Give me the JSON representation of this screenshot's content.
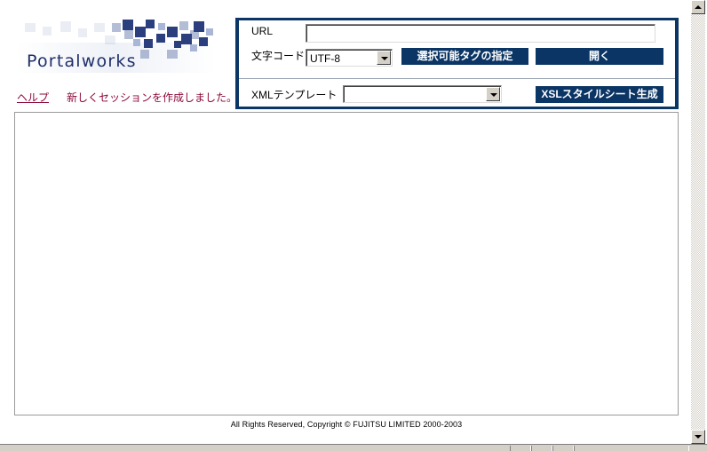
{
  "header": {
    "logo_text": "Portalworks",
    "help_link": "ヘルプ",
    "status_message": "新しくセッションを作成しました。"
  },
  "form": {
    "url_label": "URL",
    "url_value": "",
    "encoding_label": "文字コード",
    "encoding_selected": "UTF-8",
    "select_tags_button": "選択可能タグの指定",
    "open_button": "開く",
    "xml_template_label": "XMLテンプレート",
    "xml_template_selected": "",
    "generate_xsl_button": "XSLスタイルシート生成"
  },
  "footer": {
    "copyright": "All Rights Reserved, Copyright © FUJITSU LIMITED 2000-2003"
  },
  "colors": {
    "navy": "#0b3564",
    "link": "#8b0a3a"
  }
}
